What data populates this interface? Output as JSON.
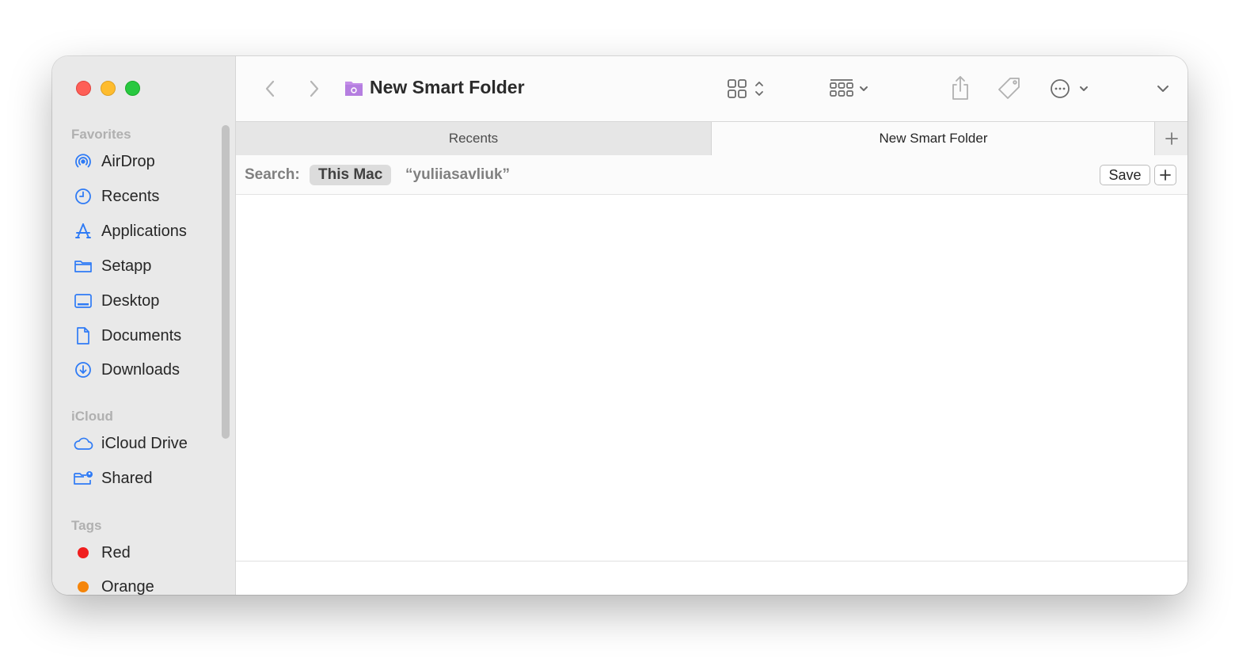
{
  "window": {
    "title": "New Smart Folder"
  },
  "sidebar": {
    "sections": {
      "favorites": "Favorites",
      "icloud": "iCloud",
      "tags": "Tags"
    },
    "favorites": [
      {
        "label": "AirDrop",
        "icon": "airdrop-icon"
      },
      {
        "label": "Recents",
        "icon": "clock-icon"
      },
      {
        "label": "Applications",
        "icon": "applications-icon"
      },
      {
        "label": "Setapp",
        "icon": "folder-icon"
      },
      {
        "label": "Desktop",
        "icon": "desktop-icon"
      },
      {
        "label": "Documents",
        "icon": "document-icon"
      },
      {
        "label": "Downloads",
        "icon": "download-icon"
      }
    ],
    "icloud": [
      {
        "label": "iCloud Drive",
        "icon": "cloud-icon"
      },
      {
        "label": "Shared",
        "icon": "shared-folder-icon"
      }
    ],
    "tags": [
      {
        "label": "Red",
        "color": "#f01e1e"
      },
      {
        "label": "Orange",
        "color": "#f5850a"
      }
    ]
  },
  "tabs": [
    {
      "label": "Recents",
      "active": false
    },
    {
      "label": "New Smart Folder",
      "active": true
    }
  ],
  "search": {
    "label": "Search:",
    "scope_selected": "This Mac",
    "scope_other": "“yuliiasavliuk”",
    "save_label": "Save"
  },
  "colors": {
    "accent": "#2f7bf5",
    "folder": "#b57ee0"
  }
}
